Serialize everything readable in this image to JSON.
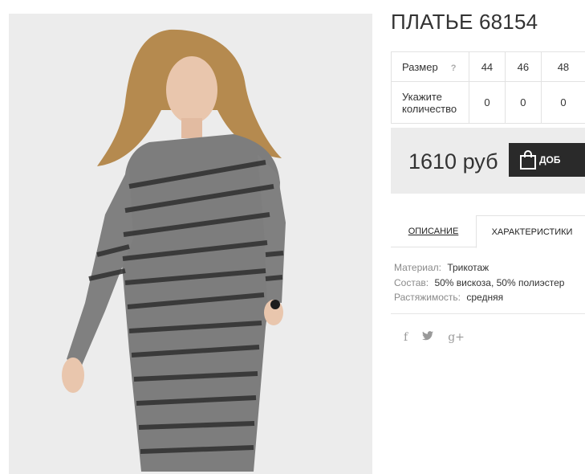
{
  "product": {
    "title": "ПЛАТЬЕ 68154"
  },
  "sizes": {
    "size_label": "Размер",
    "help": "?",
    "qty_label_1": "Укажите",
    "qty_label_2": "количество",
    "values": [
      "44",
      "46",
      "48"
    ],
    "quantities": [
      "0",
      "0",
      "0"
    ]
  },
  "purchase": {
    "price": "1610 руб",
    "button_label": "ДОБ"
  },
  "tabs": [
    {
      "label": "Описание"
    },
    {
      "label": "Характеристики"
    }
  ],
  "specs": [
    {
      "key": "Материал:",
      "value": "Трикотаж"
    },
    {
      "key": "Состав:",
      "value": "50% вискоза, 50% полиэстер"
    },
    {
      "key": "Растяжимость:",
      "value": "средняя"
    }
  ],
  "social": {
    "facebook": "f",
    "twitter": "❟",
    "googleplus": "g+"
  },
  "colors": {
    "panel_bg": "#ececec",
    "button_bg": "#2a2a2a",
    "border": "#e2e2e2"
  }
}
